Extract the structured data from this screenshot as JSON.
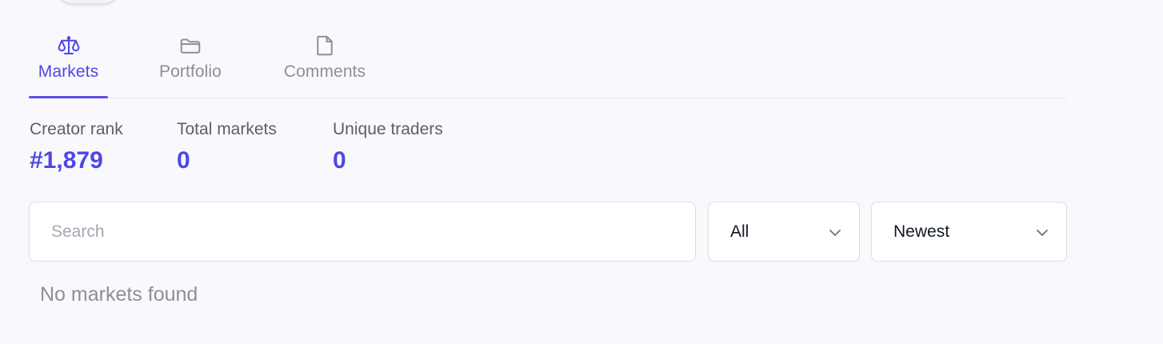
{
  "tabs": [
    {
      "label": "Markets",
      "icon": "scale-icon",
      "active": true
    },
    {
      "label": "Portfolio",
      "icon": "folder-icon",
      "active": false
    },
    {
      "label": "Comments",
      "icon": "document-icon",
      "active": false
    }
  ],
  "stats": {
    "creator_rank": {
      "label": "Creator rank",
      "value": "#1,879"
    },
    "total_markets": {
      "label": "Total markets",
      "value": "0"
    },
    "unique_traders": {
      "label": "Unique traders",
      "value": "0"
    }
  },
  "search": {
    "placeholder": "Search",
    "value": ""
  },
  "filter": {
    "selected": "All"
  },
  "sort": {
    "selected": "Newest"
  },
  "empty_state": "No markets found",
  "colors": {
    "accent": "#4f46e5",
    "muted_text": "#8b8f9a",
    "background": "#f9f9fd"
  }
}
